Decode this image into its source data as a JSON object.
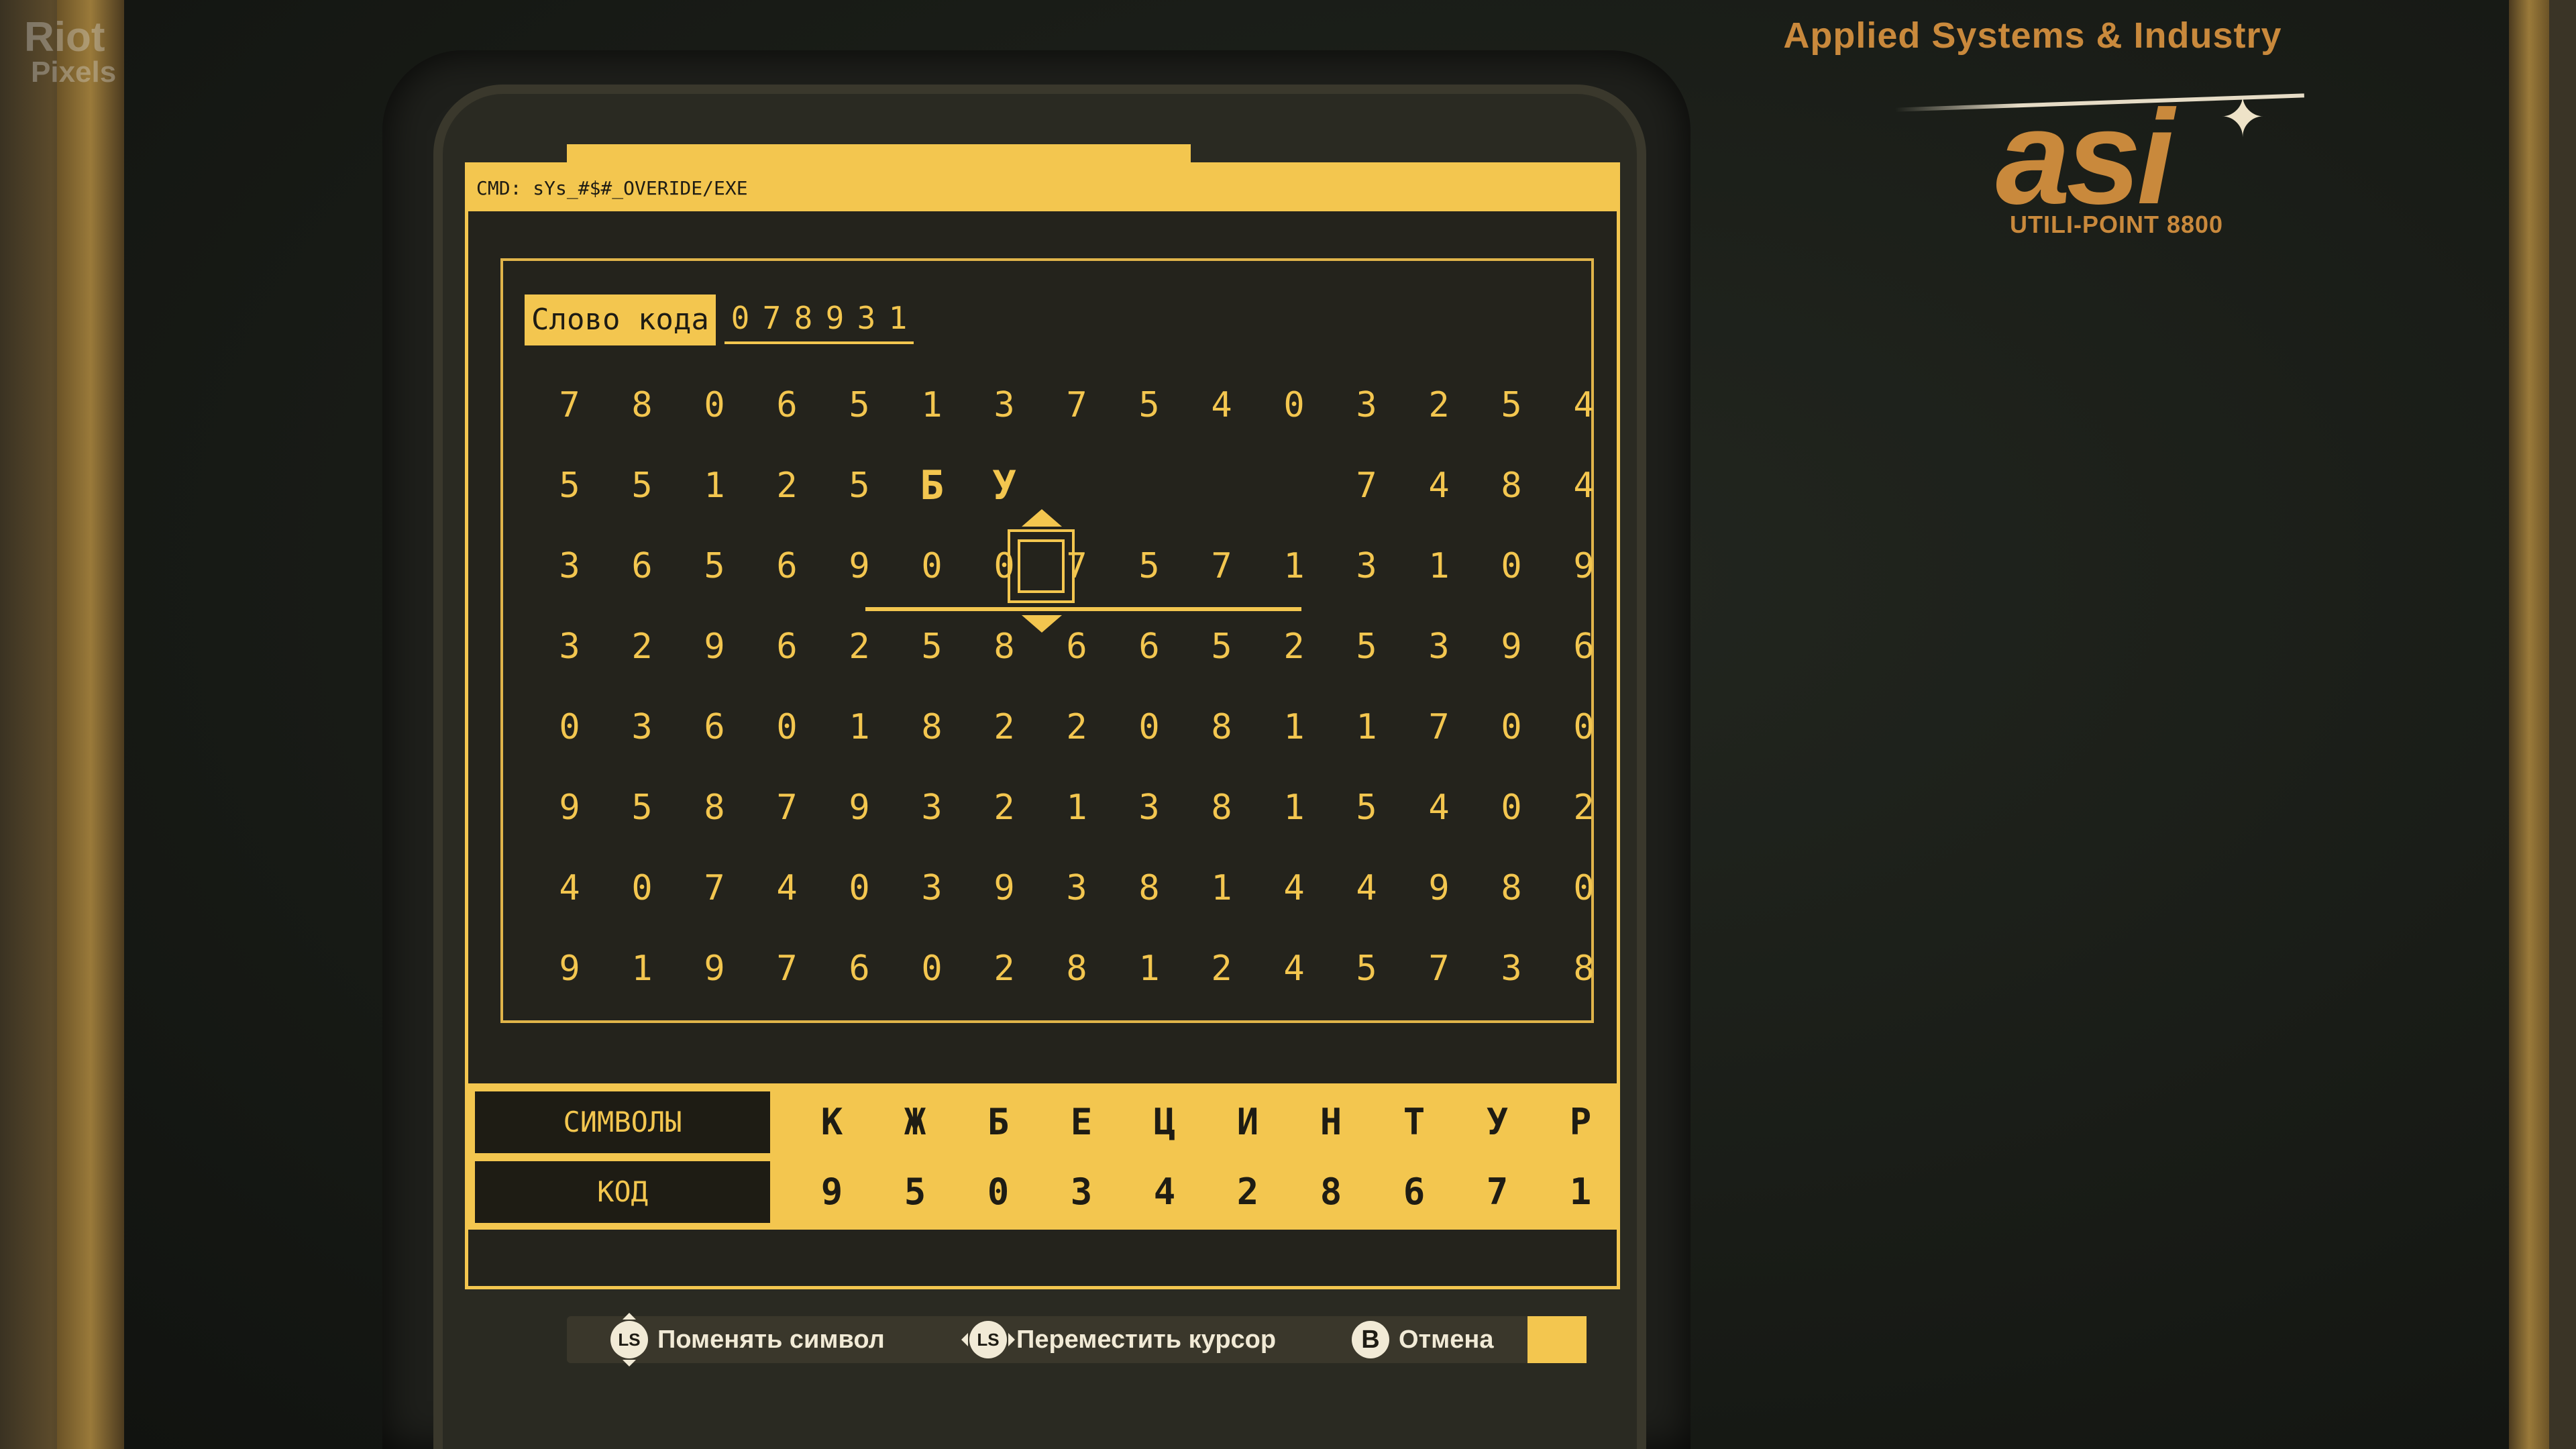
{
  "watermark": {
    "line1": "Riot",
    "line2": "Pixels"
  },
  "brand": {
    "title": "Applied Systems & Industry",
    "logo": "asi",
    "model": "UTILI-POINT 8800"
  },
  "terminal": {
    "cmd": "CMD: sYs_#$#_OVERIDE/EXE",
    "code_word_label": "Слово кода",
    "code_digits": [
      "0",
      "7",
      "8",
      "9",
      "3",
      "1"
    ]
  },
  "grid": {
    "rows": [
      [
        "7",
        "8",
        "0",
        "6",
        "5",
        "1",
        "3",
        "7",
        "5",
        "4",
        "0",
        "3",
        "2",
        "5",
        "4"
      ],
      [
        "5",
        "5",
        "1",
        "2",
        "5",
        "Б",
        "У",
        "",
        "",
        "",
        "",
        "7",
        "4",
        "8",
        "4"
      ],
      [
        "3",
        "6",
        "5",
        "6",
        "9",
        "0",
        "0",
        "7",
        "5",
        "7",
        "1",
        "3",
        "1",
        "0",
        "9"
      ],
      [
        "3",
        "2",
        "9",
        "6",
        "2",
        "5",
        "8",
        "6",
        "6",
        "5",
        "2",
        "5",
        "3",
        "9",
        "6"
      ],
      [
        "0",
        "3",
        "6",
        "0",
        "1",
        "8",
        "2",
        "2",
        "0",
        "8",
        "1",
        "1",
        "7",
        "0",
        "0"
      ],
      [
        "9",
        "5",
        "8",
        "7",
        "9",
        "3",
        "2",
        "1",
        "3",
        "8",
        "1",
        "5",
        "4",
        "0",
        "2"
      ],
      [
        "4",
        "0",
        "7",
        "4",
        "0",
        "3",
        "9",
        "3",
        "8",
        "1",
        "4",
        "4",
        "9",
        "8",
        "0"
      ],
      [
        "9",
        "1",
        "9",
        "7",
        "6",
        "0",
        "2",
        "8",
        "1",
        "2",
        "4",
        "5",
        "7",
        "3",
        "8"
      ]
    ]
  },
  "legend": {
    "symbols_label": "СИМВОЛЫ",
    "code_label": "КОД",
    "symbols": [
      "К",
      "Ж",
      "Б",
      "Е",
      "Ц",
      "И",
      "Н",
      "Т",
      "У",
      "Р"
    ],
    "codes": [
      "9",
      "5",
      "0",
      "3",
      "4",
      "2",
      "8",
      "6",
      "7",
      "1"
    ]
  },
  "prompts": {
    "change_symbol": "Поменять символ",
    "move_cursor": "Переместить курсор",
    "cancel": "Отмена",
    "ls_glyph": "LS",
    "b_glyph": "B"
  }
}
